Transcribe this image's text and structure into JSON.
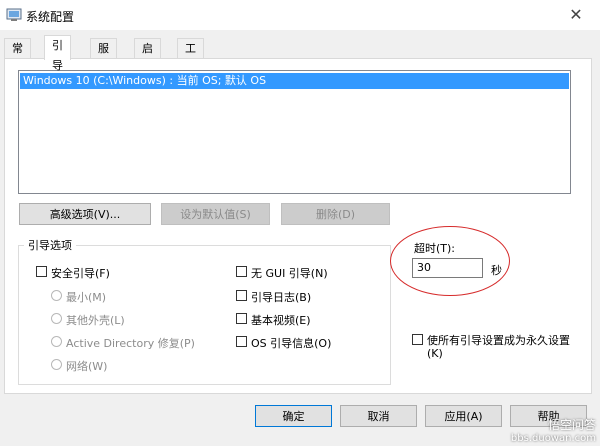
{
  "window": {
    "title": "系统配置",
    "close_symbol": "✕"
  },
  "tabs": [
    {
      "label": "常规",
      "active": false
    },
    {
      "label": "引导",
      "active": true
    },
    {
      "label": "服务",
      "active": false
    },
    {
      "label": "启动",
      "active": false
    },
    {
      "label": "工具",
      "active": false
    }
  ],
  "boot_list": {
    "items": [
      "Windows 10 (C:\\Windows) : 当前 OS; 默认 OS"
    ],
    "selected_index": 0
  },
  "buttons": {
    "advanced": "高级选项(V)...",
    "set_default": "设为默认值(S)",
    "delete": "删除(D)",
    "ok": "确定",
    "cancel": "取消",
    "apply": "应用(A)",
    "help": "帮助"
  },
  "boot_options": {
    "group_label": "引导选项",
    "safe_boot": "安全引导(F)",
    "minimal": "最小(M)",
    "alternate_shell": "其他外壳(L)",
    "active_directory": "Active Directory 修复(P)",
    "network": "网络(W)",
    "no_gui": "无 GUI 引导(N)",
    "boot_log": "引导日志(B)",
    "base_video": "基本视频(E)",
    "os_boot_info": "OS 引导信息(O)"
  },
  "timeout": {
    "label": "超时(T):",
    "value": "30",
    "unit": "秒"
  },
  "make_permanent": {
    "line1": "使所有引导设置成为永久设置",
    "line2": "(K)"
  },
  "watermark": {
    "brand": "悟空问答",
    "url": "bbs.duowan.com"
  },
  "colors": {
    "selection": "#3399ff",
    "annotation": "#d62b2b",
    "default_button_border": "#0078d7"
  }
}
